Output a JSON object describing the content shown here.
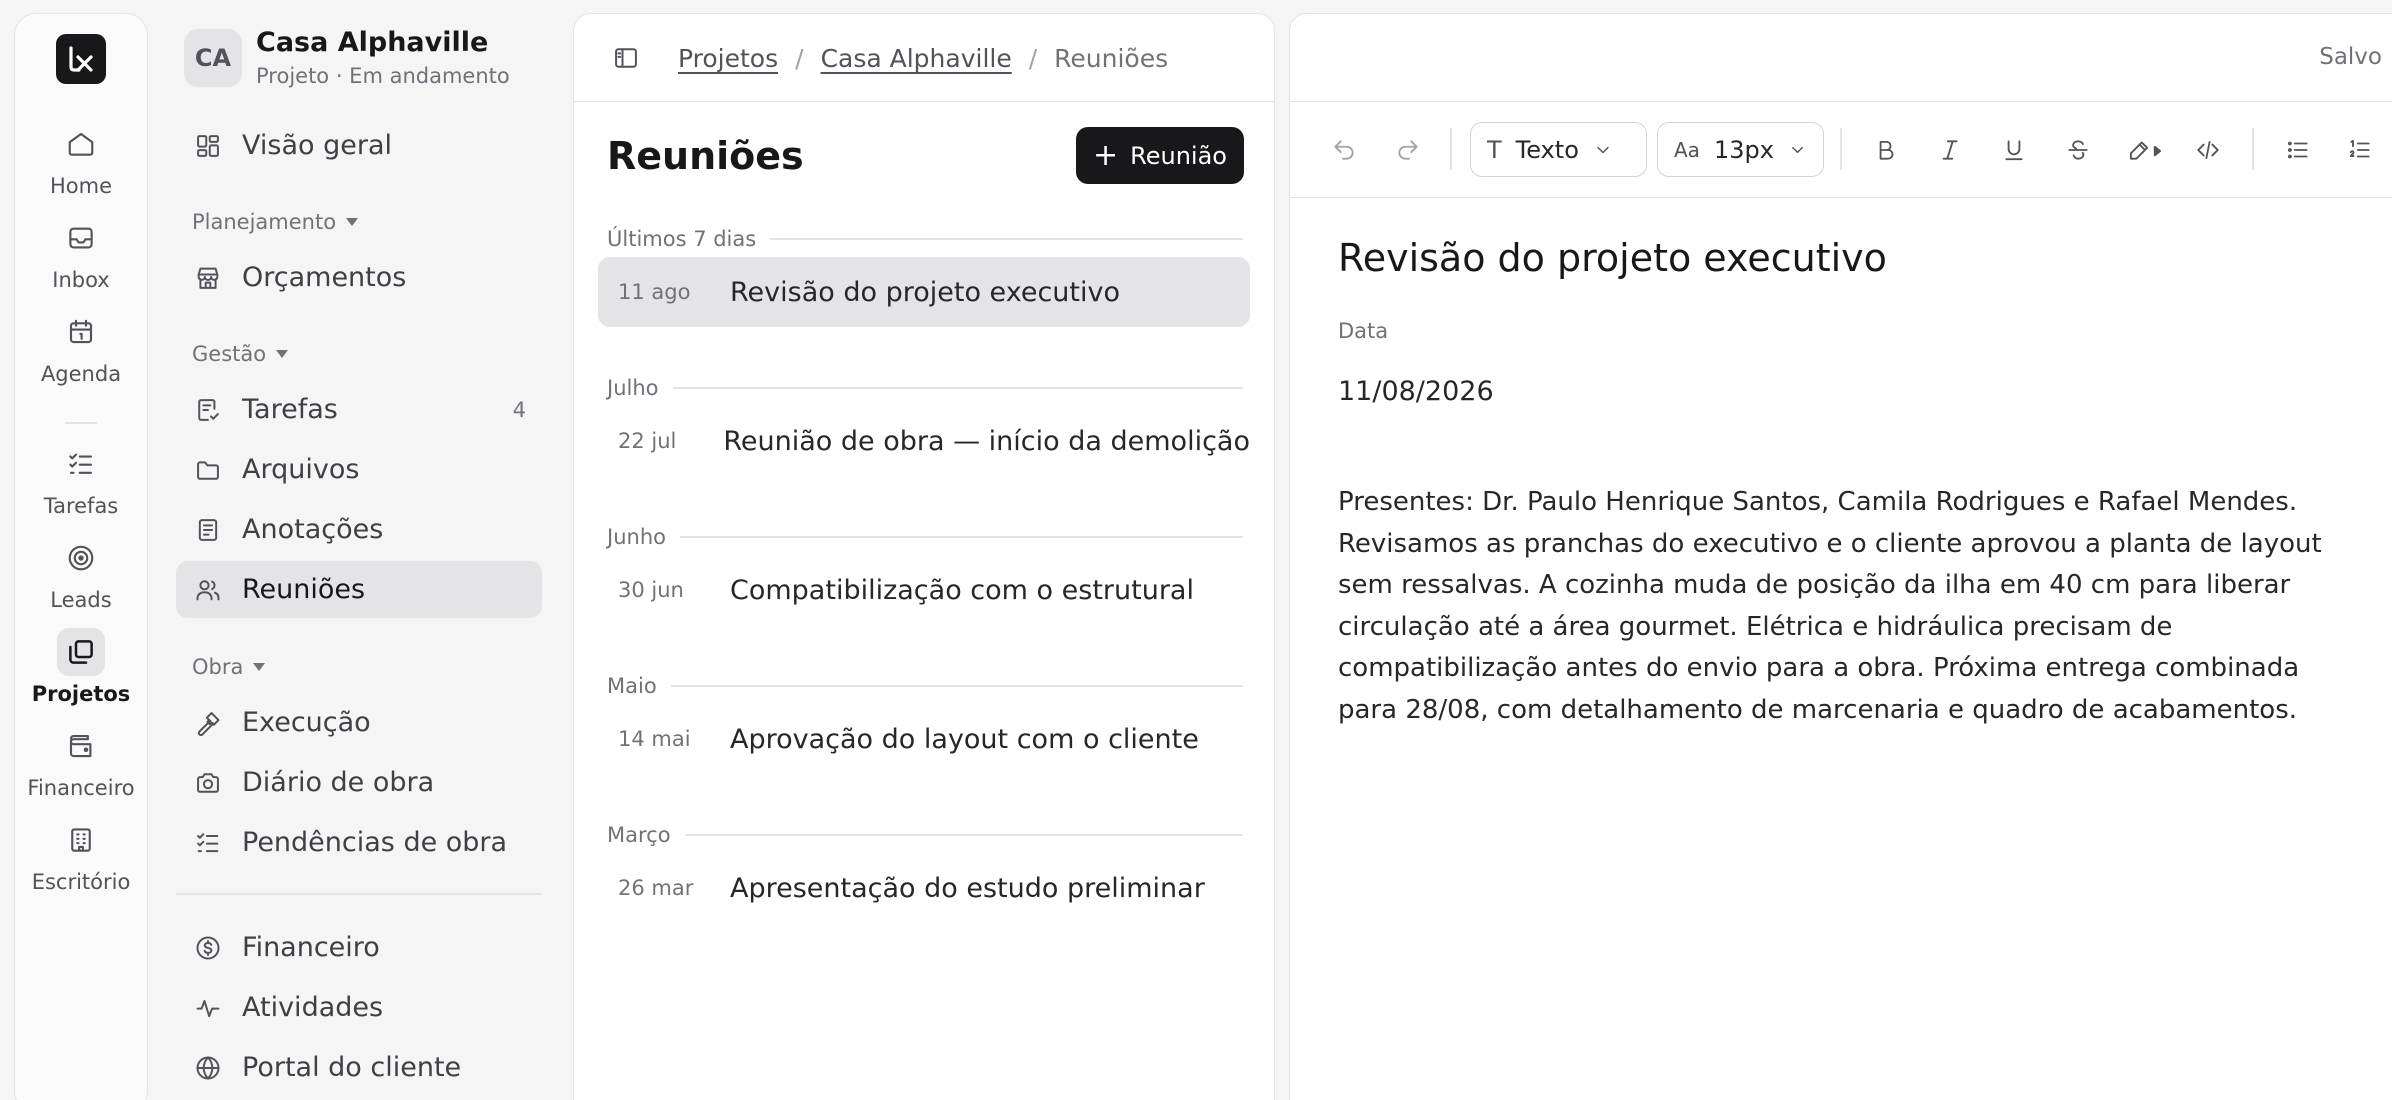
{
  "rail": {
    "items": [
      {
        "label": "Home",
        "icon": "home-icon"
      },
      {
        "label": "Inbox",
        "icon": "inbox-icon"
      },
      {
        "label": "Agenda",
        "icon": "calendar-icon"
      },
      {
        "label": "Tarefas",
        "icon": "checklist-icon"
      },
      {
        "label": "Leads",
        "icon": "target-icon"
      },
      {
        "label": "Projetos",
        "icon": "projects-icon",
        "active": true
      },
      {
        "label": "Financeiro",
        "icon": "wallet-icon"
      },
      {
        "label": "Escritório",
        "icon": "building-icon"
      }
    ]
  },
  "project": {
    "initials": "CA",
    "name": "Casa Alphaville",
    "subtitle": "Projeto · Em andamento"
  },
  "sidebar": {
    "overview": "Visão geral",
    "sections": {
      "planejamento": "Planejamento",
      "gestao": "Gestão",
      "obra": "Obra"
    },
    "items": {
      "orcamentos": "Orçamentos",
      "tarefas": "Tarefas",
      "tarefas_count": "4",
      "arquivos": "Arquivos",
      "anotacoes": "Anotações",
      "reunioes": "Reuniões",
      "execucao": "Execução",
      "diario": "Diário de obra",
      "pendencias": "Pendências de obra",
      "financeiro": "Financeiro",
      "atividades": "Atividades",
      "portal": "Portal do cliente"
    }
  },
  "breadcrumb": {
    "projetos": "Projetos",
    "projeto": "Casa Alphaville",
    "current": "Reuniões",
    "separator": "/"
  },
  "meetings": {
    "title": "Reuniões",
    "new_button": "Reunião",
    "groups": [
      {
        "label": "Últimos 7 dias",
        "items": [
          {
            "date": "11 ago",
            "title": "Revisão do projeto executivo",
            "active": true
          }
        ]
      },
      {
        "label": "Julho",
        "items": [
          {
            "date": "22 jul",
            "title": "Reunião de obra — início da demolição"
          }
        ]
      },
      {
        "label": "Junho",
        "items": [
          {
            "date": "30 jun",
            "title": "Compatibilização com o estrutural"
          }
        ]
      },
      {
        "label": "Maio",
        "items": [
          {
            "date": "14 mai",
            "title": "Aprovação do layout com o cliente"
          }
        ]
      },
      {
        "label": "Março",
        "items": [
          {
            "date": "26 mar",
            "title": "Apresentação do estudo preliminar"
          }
        ]
      }
    ]
  },
  "editor": {
    "status": "Salvo",
    "style_select": "Texto",
    "style_symbol": "T",
    "size_select": "13px",
    "size_symbol": "Aa",
    "title": "Revisão do projeto executivo",
    "date_label": "Data",
    "date_value": "11/08/2026",
    "body": "Presentes: Dr. Paulo Henrique Santos, Camila Rodrigues e Rafael Mendes. Revisamos as pranchas do executivo e o cliente aprovou a planta de layout sem ressalvas. A cozinha muda de posição da ilha em 40 cm para liberar circulação até a área gourmet. Elétrica e hidráulica precisam de compatibilização antes do envio para a obra. Próxima entrega combinada para 28/08, com detalhamento de marcenaria e quadro de acabamentos."
  }
}
